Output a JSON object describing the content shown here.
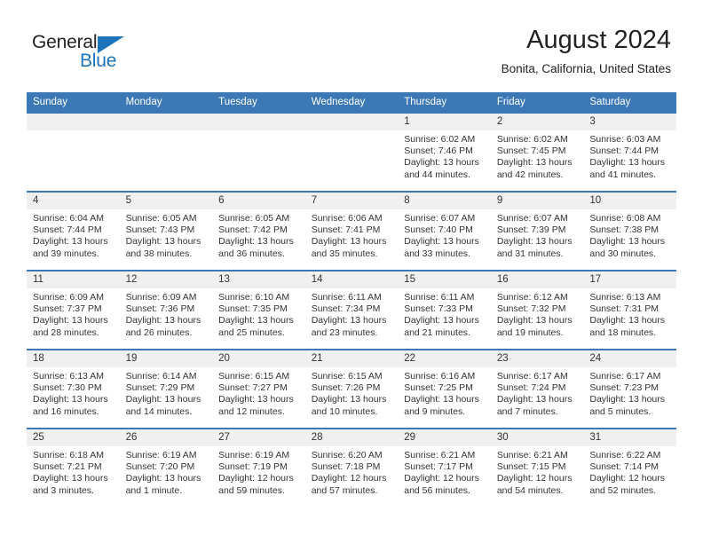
{
  "brand": {
    "name_part1": "General",
    "name_part2": "Blue",
    "accent_color": "#1b74bb"
  },
  "header": {
    "title": "August 2024",
    "subtitle": "Bonita, California, United States",
    "header_bg_color": "#3b78b5",
    "daynum_bg_color": "#f0f0f0"
  },
  "weekdays": [
    "Sunday",
    "Monday",
    "Tuesday",
    "Wednesday",
    "Thursday",
    "Friday",
    "Saturday"
  ],
  "weeks": [
    [
      {
        "day": "",
        "sunrise": "",
        "sunset": "",
        "daylight": ""
      },
      {
        "day": "",
        "sunrise": "",
        "sunset": "",
        "daylight": ""
      },
      {
        "day": "",
        "sunrise": "",
        "sunset": "",
        "daylight": ""
      },
      {
        "day": "",
        "sunrise": "",
        "sunset": "",
        "daylight": ""
      },
      {
        "day": "1",
        "sunrise": "Sunrise: 6:02 AM",
        "sunset": "Sunset: 7:46 PM",
        "daylight": "Daylight: 13 hours and 44 minutes."
      },
      {
        "day": "2",
        "sunrise": "Sunrise: 6:02 AM",
        "sunset": "Sunset: 7:45 PM",
        "daylight": "Daylight: 13 hours and 42 minutes."
      },
      {
        "day": "3",
        "sunrise": "Sunrise: 6:03 AM",
        "sunset": "Sunset: 7:44 PM",
        "daylight": "Daylight: 13 hours and 41 minutes."
      }
    ],
    [
      {
        "day": "4",
        "sunrise": "Sunrise: 6:04 AM",
        "sunset": "Sunset: 7:44 PM",
        "daylight": "Daylight: 13 hours and 39 minutes."
      },
      {
        "day": "5",
        "sunrise": "Sunrise: 6:05 AM",
        "sunset": "Sunset: 7:43 PM",
        "daylight": "Daylight: 13 hours and 38 minutes."
      },
      {
        "day": "6",
        "sunrise": "Sunrise: 6:05 AM",
        "sunset": "Sunset: 7:42 PM",
        "daylight": "Daylight: 13 hours and 36 minutes."
      },
      {
        "day": "7",
        "sunrise": "Sunrise: 6:06 AM",
        "sunset": "Sunset: 7:41 PM",
        "daylight": "Daylight: 13 hours and 35 minutes."
      },
      {
        "day": "8",
        "sunrise": "Sunrise: 6:07 AM",
        "sunset": "Sunset: 7:40 PM",
        "daylight": "Daylight: 13 hours and 33 minutes."
      },
      {
        "day": "9",
        "sunrise": "Sunrise: 6:07 AM",
        "sunset": "Sunset: 7:39 PM",
        "daylight": "Daylight: 13 hours and 31 minutes."
      },
      {
        "day": "10",
        "sunrise": "Sunrise: 6:08 AM",
        "sunset": "Sunset: 7:38 PM",
        "daylight": "Daylight: 13 hours and 30 minutes."
      }
    ],
    [
      {
        "day": "11",
        "sunrise": "Sunrise: 6:09 AM",
        "sunset": "Sunset: 7:37 PM",
        "daylight": "Daylight: 13 hours and 28 minutes."
      },
      {
        "day": "12",
        "sunrise": "Sunrise: 6:09 AM",
        "sunset": "Sunset: 7:36 PM",
        "daylight": "Daylight: 13 hours and 26 minutes."
      },
      {
        "day": "13",
        "sunrise": "Sunrise: 6:10 AM",
        "sunset": "Sunset: 7:35 PM",
        "daylight": "Daylight: 13 hours and 25 minutes."
      },
      {
        "day": "14",
        "sunrise": "Sunrise: 6:11 AM",
        "sunset": "Sunset: 7:34 PM",
        "daylight": "Daylight: 13 hours and 23 minutes."
      },
      {
        "day": "15",
        "sunrise": "Sunrise: 6:11 AM",
        "sunset": "Sunset: 7:33 PM",
        "daylight": "Daylight: 13 hours and 21 minutes."
      },
      {
        "day": "16",
        "sunrise": "Sunrise: 6:12 AM",
        "sunset": "Sunset: 7:32 PM",
        "daylight": "Daylight: 13 hours and 19 minutes."
      },
      {
        "day": "17",
        "sunrise": "Sunrise: 6:13 AM",
        "sunset": "Sunset: 7:31 PM",
        "daylight": "Daylight: 13 hours and 18 minutes."
      }
    ],
    [
      {
        "day": "18",
        "sunrise": "Sunrise: 6:13 AM",
        "sunset": "Sunset: 7:30 PM",
        "daylight": "Daylight: 13 hours and 16 minutes."
      },
      {
        "day": "19",
        "sunrise": "Sunrise: 6:14 AM",
        "sunset": "Sunset: 7:29 PM",
        "daylight": "Daylight: 13 hours and 14 minutes."
      },
      {
        "day": "20",
        "sunrise": "Sunrise: 6:15 AM",
        "sunset": "Sunset: 7:27 PM",
        "daylight": "Daylight: 13 hours and 12 minutes."
      },
      {
        "day": "21",
        "sunrise": "Sunrise: 6:15 AM",
        "sunset": "Sunset: 7:26 PM",
        "daylight": "Daylight: 13 hours and 10 minutes."
      },
      {
        "day": "22",
        "sunrise": "Sunrise: 6:16 AM",
        "sunset": "Sunset: 7:25 PM",
        "daylight": "Daylight: 13 hours and 9 minutes."
      },
      {
        "day": "23",
        "sunrise": "Sunrise: 6:17 AM",
        "sunset": "Sunset: 7:24 PM",
        "daylight": "Daylight: 13 hours and 7 minutes."
      },
      {
        "day": "24",
        "sunrise": "Sunrise: 6:17 AM",
        "sunset": "Sunset: 7:23 PM",
        "daylight": "Daylight: 13 hours and 5 minutes."
      }
    ],
    [
      {
        "day": "25",
        "sunrise": "Sunrise: 6:18 AM",
        "sunset": "Sunset: 7:21 PM",
        "daylight": "Daylight: 13 hours and 3 minutes."
      },
      {
        "day": "26",
        "sunrise": "Sunrise: 6:19 AM",
        "sunset": "Sunset: 7:20 PM",
        "daylight": "Daylight: 13 hours and 1 minute."
      },
      {
        "day": "27",
        "sunrise": "Sunrise: 6:19 AM",
        "sunset": "Sunset: 7:19 PM",
        "daylight": "Daylight: 12 hours and 59 minutes."
      },
      {
        "day": "28",
        "sunrise": "Sunrise: 6:20 AM",
        "sunset": "Sunset: 7:18 PM",
        "daylight": "Daylight: 12 hours and 57 minutes."
      },
      {
        "day": "29",
        "sunrise": "Sunrise: 6:21 AM",
        "sunset": "Sunset: 7:17 PM",
        "daylight": "Daylight: 12 hours and 56 minutes."
      },
      {
        "day": "30",
        "sunrise": "Sunrise: 6:21 AM",
        "sunset": "Sunset: 7:15 PM",
        "daylight": "Daylight: 12 hours and 54 minutes."
      },
      {
        "day": "31",
        "sunrise": "Sunrise: 6:22 AM",
        "sunset": "Sunset: 7:14 PM",
        "daylight": "Daylight: 12 hours and 52 minutes."
      }
    ]
  ]
}
